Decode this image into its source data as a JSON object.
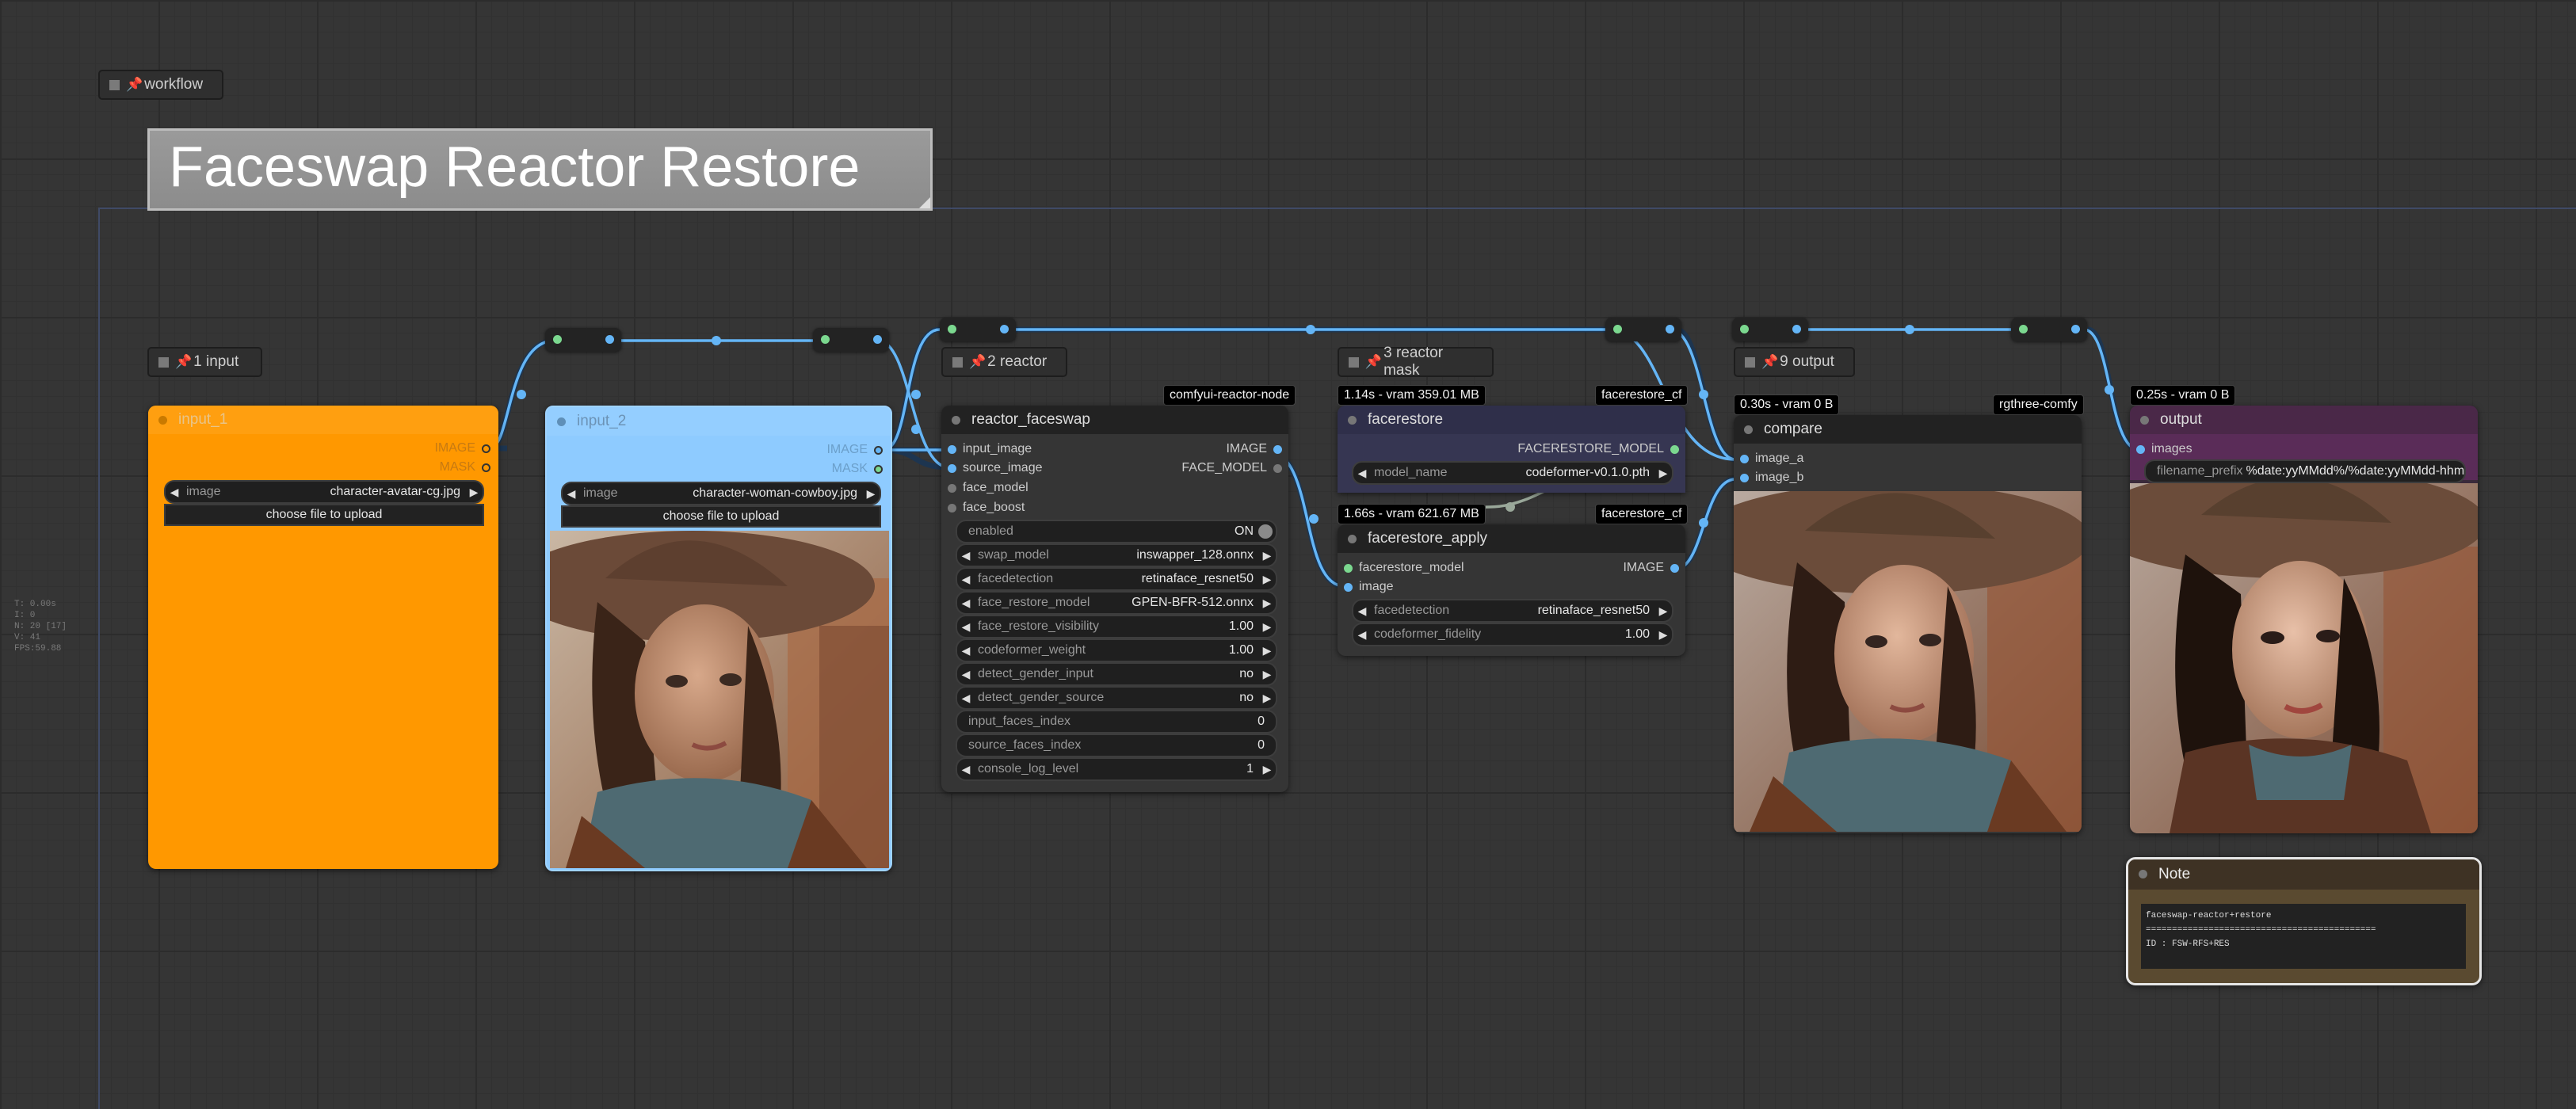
{
  "groups": {
    "workflow": "workflow",
    "input": "1 input",
    "reactor": "2 reactor",
    "reactor_mask": "3 reactor mask",
    "output": "9 output"
  },
  "title_node": "Faceswap Reactor Restore",
  "stats": [
    "T: 0.00s",
    "I: 0",
    "N: 20 [17]",
    "V: 41",
    "FPS:59.88"
  ],
  "input_1": {
    "title": "input_1",
    "out1": "IMAGE",
    "out2": "MASK",
    "widget_label": "image",
    "widget_value": "character-avatar-cg.jpg",
    "upload": "choose file to upload"
  },
  "input_2": {
    "title": "input_2",
    "out1": "IMAGE",
    "out2": "MASK",
    "widget_label": "image",
    "widget_value": "character-woman-cowboy.jpg",
    "upload": "choose file to upload"
  },
  "reactor": {
    "badge": "comfyui-reactor-node",
    "title": "reactor_faceswap",
    "inputs": [
      "input_image",
      "source_image",
      "face_model",
      "face_boost"
    ],
    "outputs": [
      "IMAGE",
      "FACE_MODEL"
    ],
    "enabled_label": "enabled",
    "enabled_value": "ON",
    "widgets": [
      {
        "label": "swap_model",
        "value": "inswapper_128.onnx"
      },
      {
        "label": "facedetection",
        "value": "retinaface_resnet50"
      },
      {
        "label": "face_restore_model",
        "value": "GPEN-BFR-512.onnx"
      },
      {
        "label": "face_restore_visibility",
        "value": "1.00"
      },
      {
        "label": "codeformer_weight",
        "value": "1.00"
      },
      {
        "label": "detect_gender_input",
        "value": "no"
      },
      {
        "label": "detect_gender_source",
        "value": "no"
      }
    ],
    "text_widgets": [
      {
        "label": "input_faces_index",
        "value": "0"
      },
      {
        "label": "source_faces_index",
        "value": "0"
      }
    ],
    "console": {
      "label": "console_log_level",
      "value": "1"
    }
  },
  "facerestore": {
    "time_badge": "1.14s - vram 359.01 MB",
    "badge": "facerestore_cf",
    "title": "facerestore",
    "output": "FACERESTORE_MODEL",
    "widget_label": "model_name",
    "widget_value": "codeformer-v0.1.0.pth"
  },
  "facerestore_apply": {
    "time_badge": "1.66s - vram 621.67 MB",
    "badge": "facerestore_cf",
    "title": "facerestore_apply",
    "inputs": [
      "facerestore_model",
      "image"
    ],
    "output": "IMAGE",
    "widgets": [
      {
        "label": "facedetection",
        "value": "retinaface_resnet50"
      },
      {
        "label": "codeformer_fidelity",
        "value": "1.00"
      }
    ]
  },
  "compare": {
    "time_badge": "0.30s - vram 0 B",
    "badge": "rgthree-comfy",
    "title": "compare",
    "inputs": [
      "image_a",
      "image_b"
    ]
  },
  "output": {
    "time_badge": "0.25s - vram 0 B",
    "title": "output",
    "input": "images",
    "prefix_label": "filename_prefix",
    "prefix_value": "%date:yyMMdd%/%date:yyMMdd-hhm"
  },
  "note": {
    "title": "Note",
    "line1": "faceswap-reactor+restore",
    "line2": "============================================",
    "line3": "ID   : FSW-RFS+RES"
  },
  "colors": {
    "link_image": "#64b5f6",
    "link_green": "#7bd88f",
    "input_1_bg": "#ff9800",
    "input_2_bg": "#8ecbff",
    "facerestore_head": "#2f2f4a",
    "output_head": "#4a2848"
  }
}
